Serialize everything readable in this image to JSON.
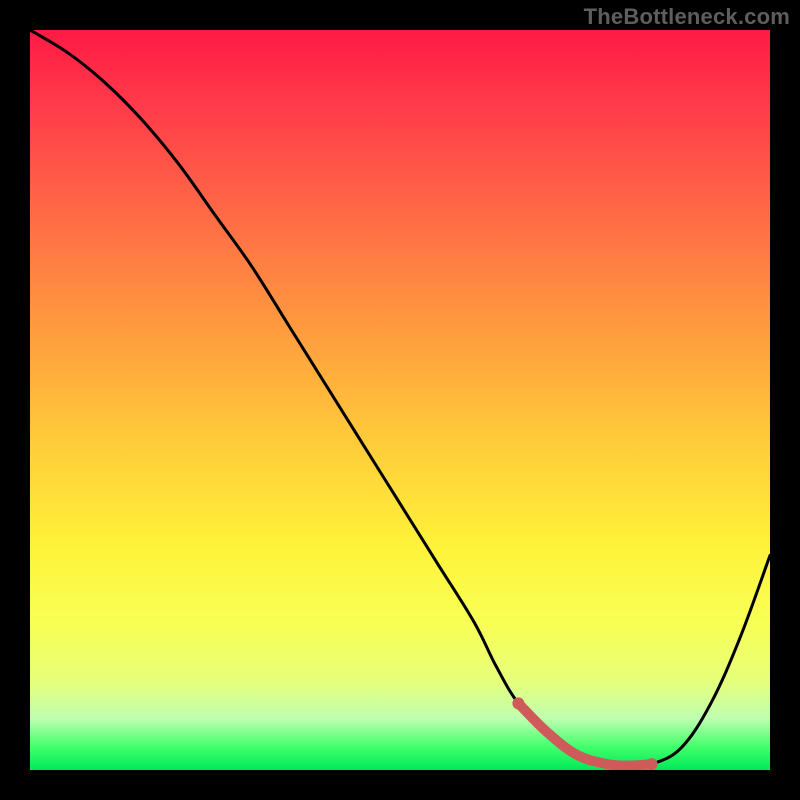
{
  "watermark": "TheBottleneck.com",
  "chart_data": {
    "type": "line",
    "title": "",
    "xlabel": "",
    "ylabel": "",
    "xlim": [
      0,
      100
    ],
    "ylim": [
      0,
      100
    ],
    "series": [
      {
        "name": "bottleneck-curve",
        "x": [
          0,
          5,
          10,
          15,
          20,
          25,
          30,
          35,
          40,
          45,
          50,
          55,
          60,
          63,
          66,
          70,
          74,
          78,
          81,
          84,
          88,
          92,
          96,
          100
        ],
        "y": [
          100,
          97,
          93,
          88,
          82,
          75,
          68,
          60,
          52,
          44,
          36,
          28,
          20,
          14,
          9,
          5,
          2,
          0.8,
          0.6,
          0.8,
          3,
          9,
          18,
          29
        ]
      }
    ],
    "highlight_segment": {
      "name": "optimal-range",
      "x": [
        66,
        70,
        74,
        78,
        81,
        84
      ],
      "y": [
        9,
        5,
        2,
        0.8,
        0.6,
        0.8
      ]
    },
    "gradient_stops": [
      {
        "pos": 0,
        "color": "#ff1a44"
      },
      {
        "pos": 10,
        "color": "#ff3a4a"
      },
      {
        "pos": 25,
        "color": "#ff6a46"
      },
      {
        "pos": 40,
        "color": "#ff9a3f"
      },
      {
        "pos": 55,
        "color": "#ffc93a"
      },
      {
        "pos": 70,
        "color": "#fff33a"
      },
      {
        "pos": 80,
        "color": "#f8ff55"
      },
      {
        "pos": 88,
        "color": "#e6ff7a"
      },
      {
        "pos": 93,
        "color": "#bfffb0"
      },
      {
        "pos": 97,
        "color": "#3fff6a"
      },
      {
        "pos": 100,
        "color": "#00e85a"
      }
    ],
    "colors": {
      "curve": "#000000",
      "highlight": "#cf5a5a",
      "background_frame": "#000000"
    }
  }
}
